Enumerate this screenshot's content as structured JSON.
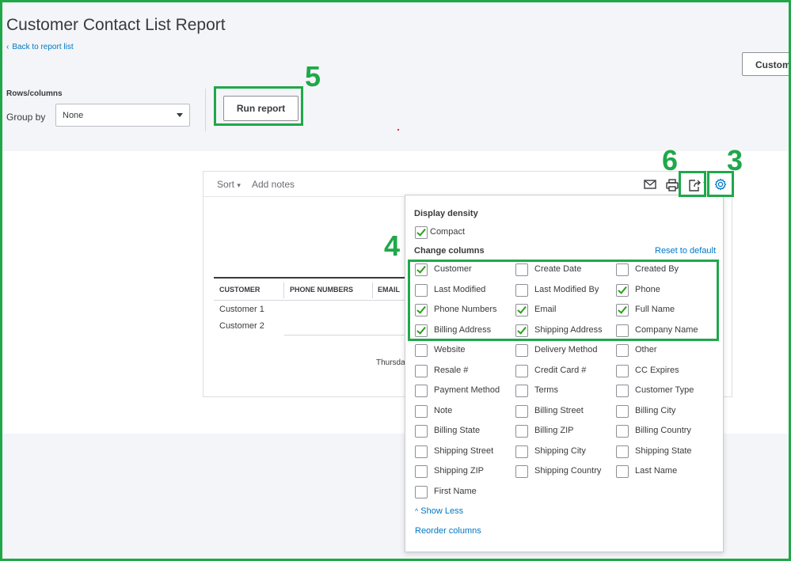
{
  "header": {
    "title": "Customer Contact List Report",
    "back_link": "Back to report list",
    "customize_button": "Customize",
    "rows_columns_label": "Rows/columns",
    "group_by_label": "Group by",
    "group_by_value": "None",
    "run_report_button": "Run report"
  },
  "toolbar": {
    "sort_label": "Sort",
    "add_notes_label": "Add notes",
    "icons": [
      "email-icon",
      "print-icon",
      "export-icon",
      "gear-icon"
    ]
  },
  "table": {
    "columns": [
      "CUSTOMER",
      "PHONE NUMBERS",
      "EMAIL"
    ],
    "rows": [
      "Customer 1",
      "Customer 2"
    ],
    "footer_fragment": "Thursda"
  },
  "panel": {
    "display_density_title": "Display density",
    "compact_label": "Compact",
    "compact_checked": true,
    "change_columns_title": "Change columns",
    "reset_label": "Reset to default",
    "columns": [
      {
        "label": "Customer",
        "checked": true
      },
      {
        "label": "Create Date",
        "checked": false
      },
      {
        "label": "Created By",
        "checked": false
      },
      {
        "label": "Last Modified",
        "checked": false
      },
      {
        "label": "Last Modified By",
        "checked": false
      },
      {
        "label": "Phone",
        "checked": true
      },
      {
        "label": "Phone Numbers",
        "checked": true
      },
      {
        "label": "Email",
        "checked": true
      },
      {
        "label": "Full Name",
        "checked": true
      },
      {
        "label": "Billing Address",
        "checked": true
      },
      {
        "label": "Shipping Address",
        "checked": true
      },
      {
        "label": "Company Name",
        "checked": false
      },
      {
        "label": "Website",
        "checked": false
      },
      {
        "label": "Delivery Method",
        "checked": false
      },
      {
        "label": "Other",
        "checked": false
      },
      {
        "label": "Resale #",
        "checked": false
      },
      {
        "label": "Credit Card #",
        "checked": false
      },
      {
        "label": "CC Expires",
        "checked": false
      },
      {
        "label": "Payment Method",
        "checked": false
      },
      {
        "label": "Terms",
        "checked": false
      },
      {
        "label": "Customer Type",
        "checked": false
      },
      {
        "label": "Note",
        "checked": false
      },
      {
        "label": "Billing Street",
        "checked": false
      },
      {
        "label": "Billing City",
        "checked": false
      },
      {
        "label": "Billing State",
        "checked": false
      },
      {
        "label": "Billing ZIP",
        "checked": false
      },
      {
        "label": "Billing Country",
        "checked": false
      },
      {
        "label": "Shipping Street",
        "checked": false
      },
      {
        "label": "Shipping City",
        "checked": false
      },
      {
        "label": "Shipping State",
        "checked": false
      },
      {
        "label": "Shipping ZIP",
        "checked": false
      },
      {
        "label": "Shipping Country",
        "checked": false
      },
      {
        "label": "Last Name",
        "checked": false
      },
      {
        "label": "First Name",
        "checked": false
      }
    ],
    "show_less_label": "Show Less",
    "reorder_label": "Reorder columns"
  },
  "annotations": {
    "step_3": "3",
    "step_4": "4",
    "step_5": "5",
    "step_6": "6",
    "color": "#1fa84a"
  }
}
